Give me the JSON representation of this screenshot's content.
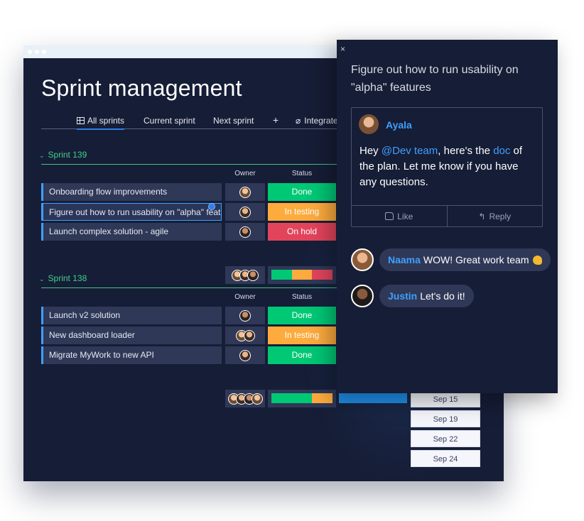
{
  "board": {
    "title": "Sprint management",
    "tabs": [
      {
        "label": "All sprints",
        "active": true,
        "icon": "table-icon"
      },
      {
        "label": "Current sprint"
      },
      {
        "label": "Next sprint"
      },
      {
        "label": "+"
      },
      {
        "label": "Integrate",
        "icon": "plug-icon"
      }
    ],
    "groups": [
      {
        "name": "Sprint 139",
        "column_headers": {
          "owner": "Owner",
          "status": "Status"
        },
        "rows": [
          {
            "name": "Onboarding flow improvements",
            "status": "Done"
          },
          {
            "name": "Figure out how to run usability on \"alpha\" features",
            "status": "In testing"
          },
          {
            "name": "Launch complex solution - agile",
            "status": "On hold"
          }
        ]
      },
      {
        "name": "Sprint 138",
        "column_headers": {
          "owner": "Owner",
          "status": "Status"
        },
        "rows": [
          {
            "name": "Launch v2 solution",
            "status": "Done"
          },
          {
            "name": "New dashboard loader",
            "status": "In testing"
          },
          {
            "name": "Migrate MyWork to new API",
            "status": "Done"
          }
        ]
      }
    ],
    "dates": [
      "Sep 15",
      "Sep 19",
      "Sep 22",
      "Sep 24"
    ],
    "status_colors": {
      "done": "#00c875",
      "testing": "#fdab3d",
      "hold": "#e2445c"
    }
  },
  "panel": {
    "close": "×",
    "title": "Figure out how to run usability on \"alpha\" features",
    "post": {
      "author": "Ayala",
      "body_prefix": "Hey ",
      "mention": "@Dev team",
      "body_mid": ", here's the ",
      "link": "doc",
      "body_suffix": " of the plan. Let me know if you have any questions.",
      "like_label": "Like",
      "reply_label": "Reply"
    },
    "replies": [
      {
        "author": "Naama",
        "text": "WOW! Great work team",
        "emoji": "flexed-biceps-icon"
      },
      {
        "author": "Justin",
        "text": "Let's do it!"
      }
    ]
  }
}
